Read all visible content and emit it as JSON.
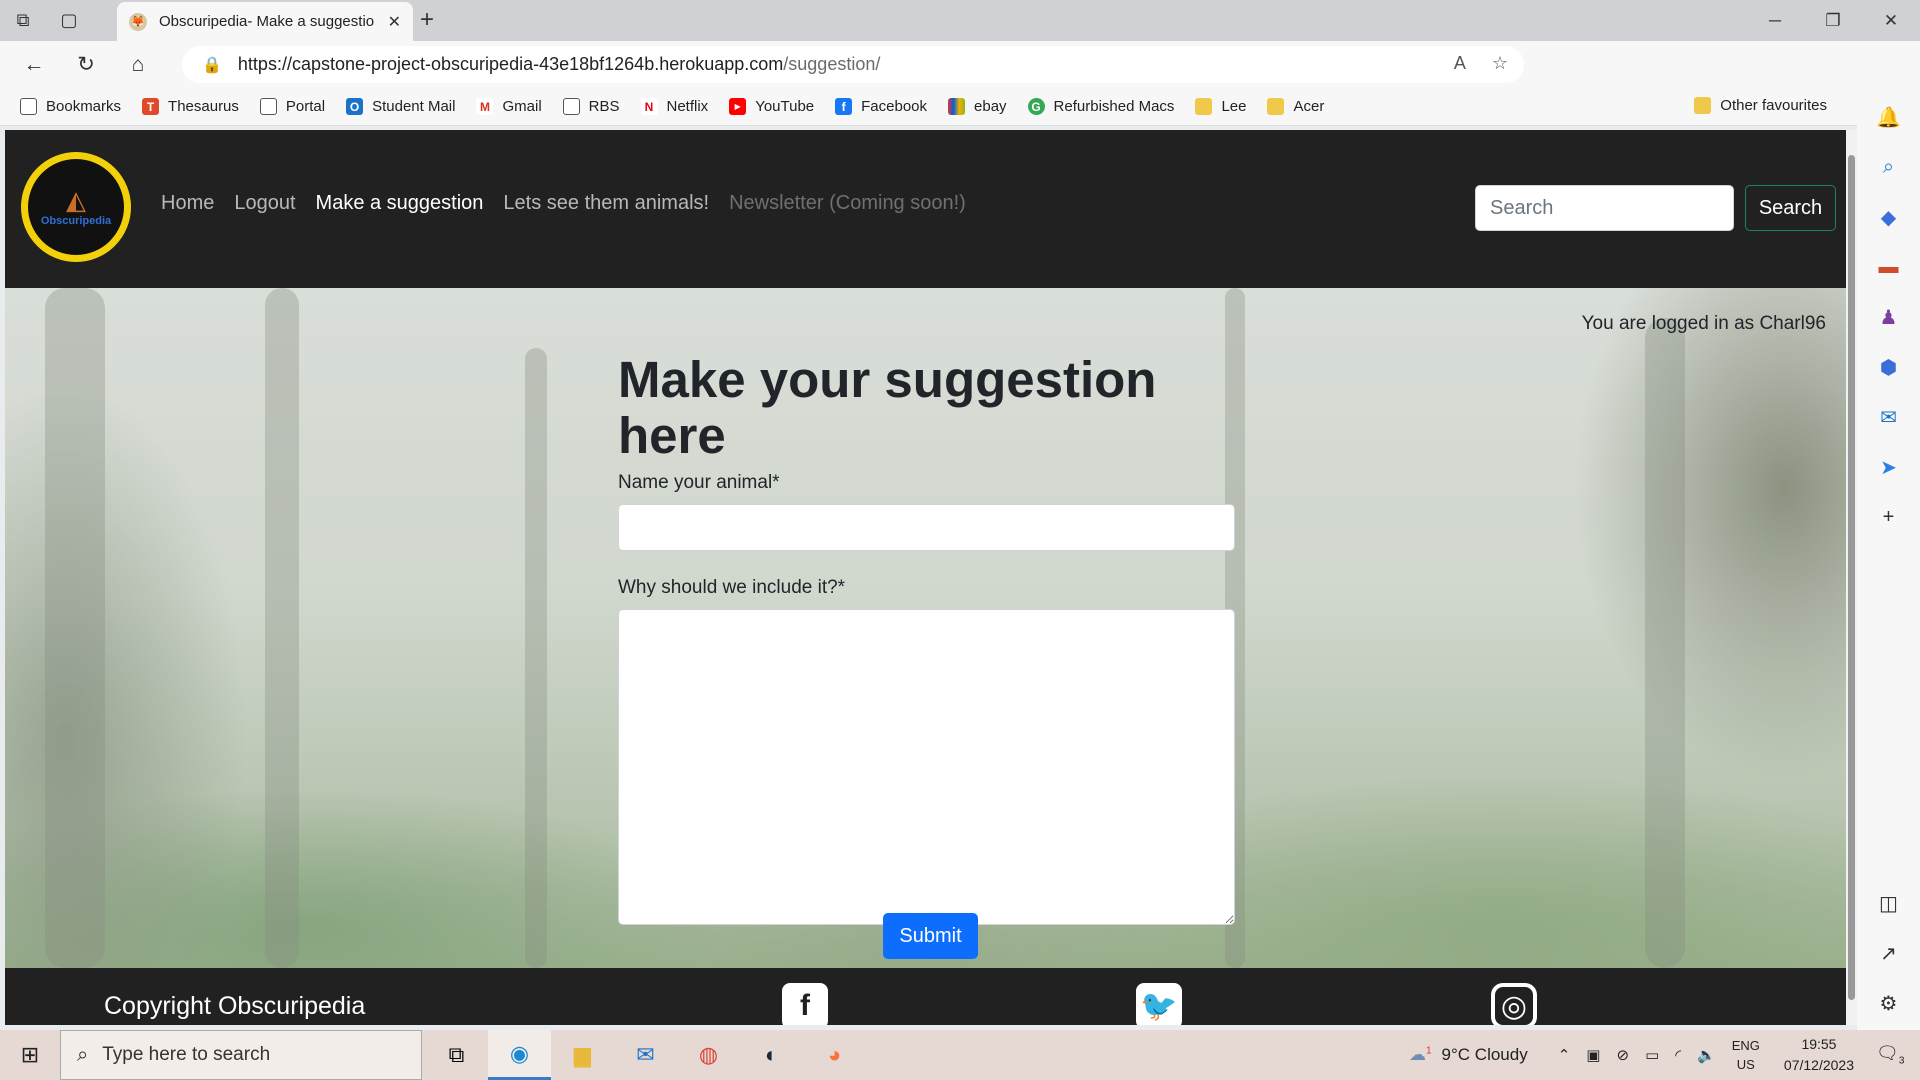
{
  "browser": {
    "tab_title": "Obscuripedia- Make a suggestio",
    "url_host": "https://capstone-project-obscuripedia-43e18bf1264b.herokuapp.com",
    "url_path": "/suggestion/",
    "bookmarks": [
      {
        "label": "Bookmarks",
        "icon": "page-icon",
        "color": "#555555"
      },
      {
        "label": "Thesaurus",
        "icon": "thesaurus-icon",
        "color": "#e04a2a"
      },
      {
        "label": "Portal",
        "icon": "page-icon",
        "color": "#555555"
      },
      {
        "label": "Student Mail",
        "icon": "outlook-icon",
        "color": "#1a73c8"
      },
      {
        "label": "Gmail",
        "icon": "gmail-icon",
        "color": "#d93025"
      },
      {
        "label": "RBS",
        "icon": "page-icon",
        "color": "#555555"
      },
      {
        "label": "Netflix",
        "icon": "netflix-icon",
        "color": "#e50914"
      },
      {
        "label": "YouTube",
        "icon": "youtube-icon",
        "color": "#ff0000"
      },
      {
        "label": "Facebook",
        "icon": "facebook-icon",
        "color": "#1877f2"
      },
      {
        "label": "ebay",
        "icon": "ebay-icon",
        "color": "#e53238"
      },
      {
        "label": "Refurbished Macs",
        "icon": "refurb-icon",
        "color": "#34a853"
      },
      {
        "label": "Lee",
        "icon": "folder-icon",
        "color": "#e8b93b"
      },
      {
        "label": "Acer",
        "icon": "folder-icon",
        "color": "#e8b93b"
      }
    ],
    "other_favourites": "Other favourites"
  },
  "site": {
    "logo_text": "Obscuripedia",
    "nav": {
      "home": "Home",
      "logout": "Logout",
      "suggestion": "Make a suggestion",
      "animals": "Lets see them animals!",
      "newsletter": "Newsletter (Coming soon!)"
    },
    "search_placeholder": "Search",
    "search_button": "Search",
    "logged_in": "You are logged in as Charl96",
    "heading": "Make your suggestion here",
    "name_label": "Name your animal*",
    "name_value": "",
    "reason_label": "Why should we include it?*",
    "reason_value": "",
    "submit": "Submit",
    "copyright": "Copyright Obscuripedia",
    "colors": {
      "navbar": "#212121",
      "accent_yellow": "#f2d10b",
      "submit_blue": "#0d6efd",
      "search_border": "#198754"
    }
  },
  "taskbar": {
    "search_placeholder": "Type here to search",
    "weather": "9°C  Cloudy",
    "weather_badge": "1",
    "lang_top": "ENG",
    "lang_bottom": "US",
    "time": "19:55",
    "date": "07/12/2023",
    "notifications": "3"
  }
}
